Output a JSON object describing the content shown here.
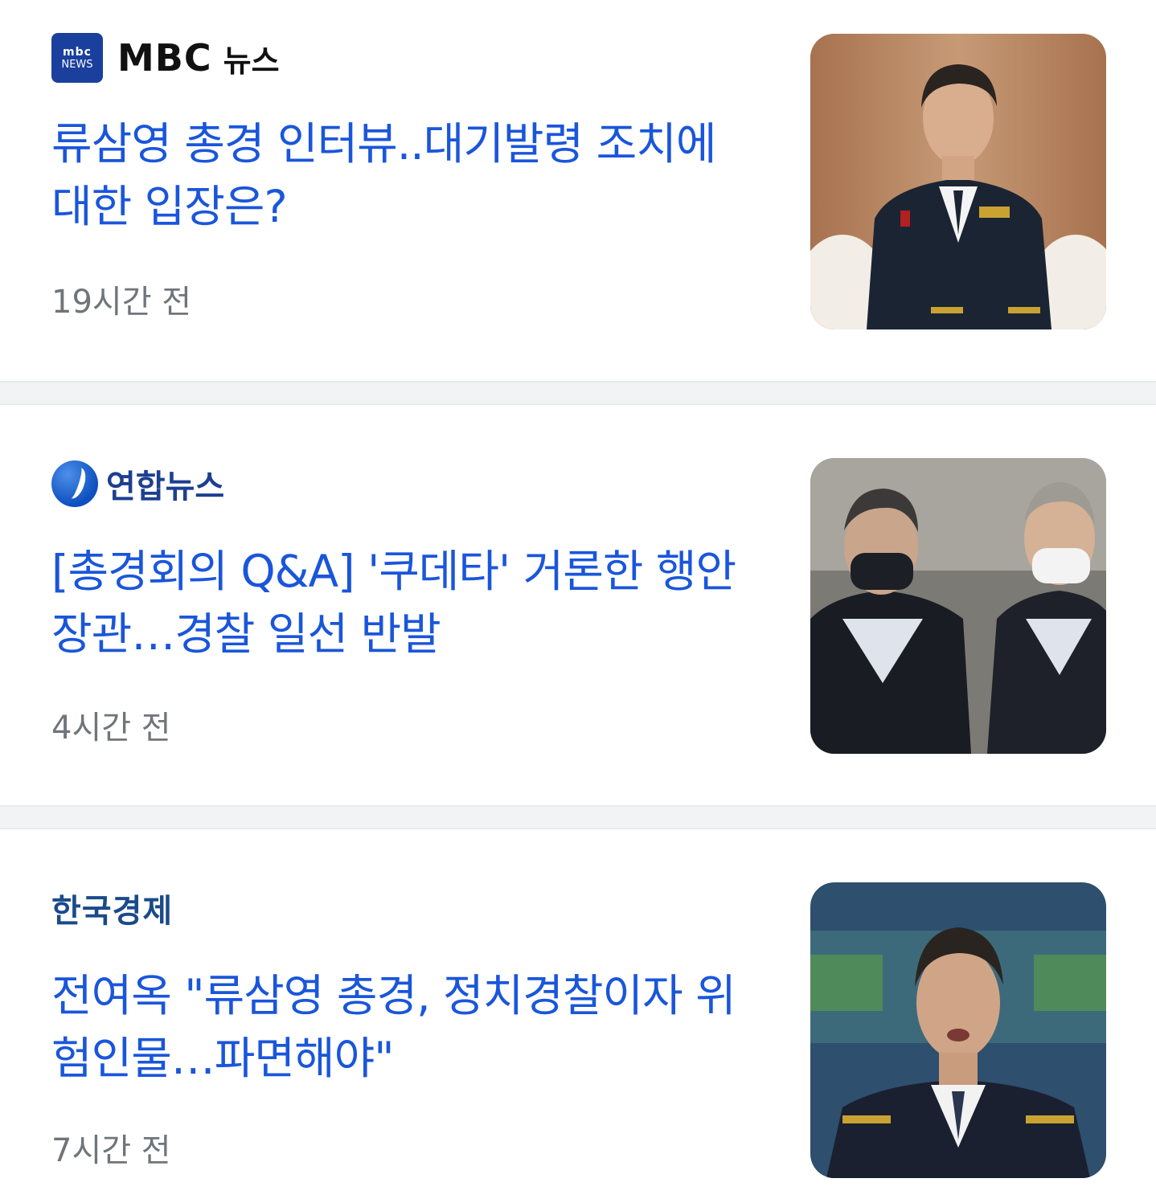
{
  "articles": [
    {
      "source": {
        "logo_badge_line1": "mbc",
        "logo_badge_line2": "NEWS",
        "name": "MBC",
        "suffix": "뉴스"
      },
      "title": "류삼영 총경 인터뷰..대기발령 조치에 대한 입장은?",
      "time": "19시간 전",
      "thumbnail_icon": "police-officer-portrait"
    },
    {
      "source": {
        "name": "연합뉴스"
      },
      "title": "[총경회의 Q&A] '쿠데타' 거론한 행안장관…경찰 일선 반발",
      "time": "4시간 전",
      "thumbnail_icon": "two-men-masks-photo"
    },
    {
      "source": {
        "name": "한국경제"
      },
      "title": "전여옥 \"류삼영 총경, 정치경찰이자 위험인물…파면해야\"",
      "time": "7시간 전",
      "thumbnail_icon": "police-officer-speaking-photo"
    }
  ],
  "colors": {
    "title": "#1a56db",
    "time": "#70757a",
    "separator": "#f1f3f4"
  }
}
